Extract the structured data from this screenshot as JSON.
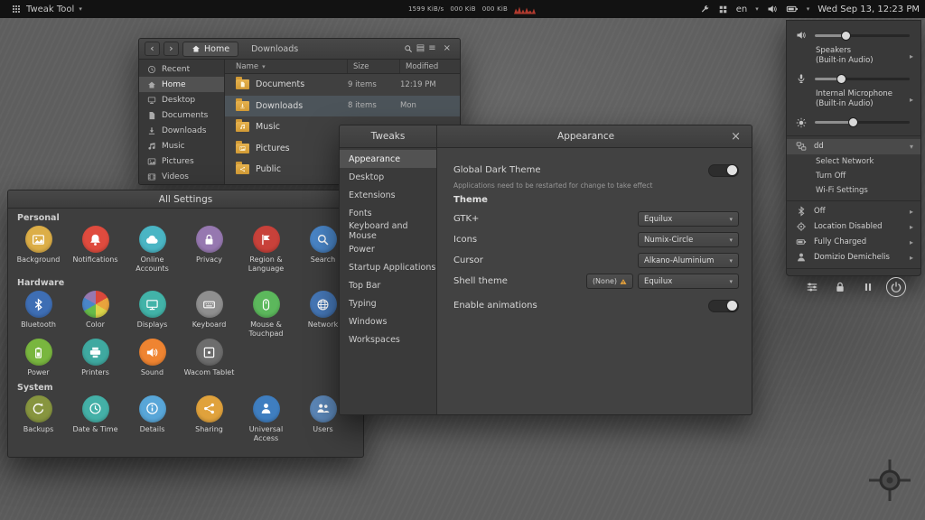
{
  "topbar": {
    "app_menu_label": "Tweak Tool",
    "net_rate": "1599 KiB/s",
    "net_down": "000 KiB",
    "net_up": "000 KiB",
    "keyboard_layout": "en",
    "clock": "Wed Sep 13, 12:23 PM"
  },
  "files_window": {
    "tabs": [
      {
        "label": "Home",
        "icon": "home"
      },
      {
        "label": "Downloads"
      }
    ],
    "sidebar_items": [
      {
        "label": "Recent",
        "icon": "recent-clock"
      },
      {
        "label": "Home",
        "icon": "home"
      },
      {
        "label": "Desktop",
        "icon": "desktop-monitor"
      },
      {
        "label": "Documents",
        "icon": "document"
      },
      {
        "label": "Downloads",
        "icon": "download-arrow"
      },
      {
        "label": "Music",
        "icon": "music-note"
      },
      {
        "label": "Pictures",
        "icon": "photo"
      },
      {
        "label": "Videos",
        "icon": "film"
      }
    ],
    "selected_sidebar": "Home",
    "columns": {
      "name": "Name",
      "size": "Size",
      "modified": "Modified"
    },
    "rows": [
      {
        "name": "Documents",
        "size": "9 items",
        "modified": "12:19 PM",
        "emblem": "document",
        "selected": false
      },
      {
        "name": "Downloads",
        "size": "8 items",
        "modified": "Mon",
        "emblem": "download-arrow",
        "selected": true
      },
      {
        "name": "Music",
        "size": "",
        "modified": "",
        "emblem": "music-note",
        "selected": false
      },
      {
        "name": "Pictures",
        "size": "",
        "modified": "",
        "emblem": "photo",
        "selected": false
      },
      {
        "name": "Public",
        "size": "",
        "modified": "",
        "emblem": "share",
        "selected": false
      }
    ]
  },
  "settings_window": {
    "title": "All Settings",
    "sections": [
      {
        "title": "Personal",
        "items": [
          {
            "label": "Background",
            "icon": "photo",
            "color": "#dcae47"
          },
          {
            "label": "Notifications",
            "icon": "bell",
            "color": "#df4b3e"
          },
          {
            "label": "Online Accounts",
            "icon": "cloud",
            "color": "#4ab5c4"
          },
          {
            "label": "Privacy",
            "icon": "lock",
            "color": "#9678b0"
          },
          {
            "label": "Region & Language",
            "icon": "flag",
            "color": "#c8413a"
          },
          {
            "label": "Search",
            "icon": "search",
            "color": "#4a86c8"
          }
        ]
      },
      {
        "title": "Hardware",
        "items": [
          {
            "label": "Bluetooth",
            "icon": "bluetooth",
            "color": "#3e6eb4"
          },
          {
            "label": "Color",
            "icon": "color-wheel",
            "color": ""
          },
          {
            "label": "Displays",
            "icon": "monitor",
            "color": "#42b3a8"
          },
          {
            "label": "Keyboard",
            "icon": "keyboard",
            "color": "#8f8f8f"
          },
          {
            "label": "Mouse & Touchpad",
            "icon": "mouse",
            "color": "#5cb85c"
          },
          {
            "label": "Network",
            "icon": "globe",
            "color": "#4678b8"
          },
          {
            "label": "Power",
            "icon": "battery",
            "color": "#79b63f"
          },
          {
            "label": "Printers",
            "icon": "printer",
            "color": "#3fa9a0"
          },
          {
            "label": "Sound",
            "icon": "speaker",
            "color": "#ef8431"
          },
          {
            "label": "Wacom Tablet",
            "icon": "tablet",
            "color": "#6d6d6d"
          }
        ]
      },
      {
        "title": "System",
        "items": [
          {
            "label": "Backups",
            "icon": "backup-arrows",
            "color": "#87953f"
          },
          {
            "label": "Date & Time",
            "icon": "clock",
            "color": "#44b0a7"
          },
          {
            "label": "Details",
            "icon": "info",
            "color": "#58a6d8"
          },
          {
            "label": "Sharing",
            "icon": "share",
            "color": "#e0a23c"
          },
          {
            "label": "Universal Access",
            "icon": "person",
            "color": "#3f7ec0"
          },
          {
            "label": "Users",
            "icon": "people",
            "color": "#5c87b8"
          }
        ]
      }
    ]
  },
  "tweaks_window": {
    "sidebar_title": "Tweaks",
    "page_title": "Appearance",
    "sidebar_items": [
      {
        "label": "Appearance",
        "selected": true
      },
      {
        "label": "Desktop",
        "selected": false
      },
      {
        "label": "Extensions",
        "selected": false
      },
      {
        "label": "Fonts",
        "selected": false
      },
      {
        "label": "Keyboard and Mouse",
        "selected": false
      },
      {
        "label": "Power",
        "selected": false
      },
      {
        "label": "Startup Applications",
        "selected": false
      },
      {
        "label": "Top Bar",
        "selected": false
      },
      {
        "label": "Typing",
        "selected": false
      },
      {
        "label": "Windows",
        "selected": false
      },
      {
        "label": "Workspaces",
        "selected": false
      }
    ],
    "dark_theme": {
      "label": "Global Dark Theme",
      "on": true,
      "note": "Applications need to be restarted for change to take effect"
    },
    "theme_heading": "Theme",
    "rows": [
      {
        "label": "GTK+",
        "value": "Equilux"
      },
      {
        "label": "Icons",
        "value": "Numix-Circle"
      },
      {
        "label": "Cursor",
        "value": "Alkano-Aluminium"
      },
      {
        "label": "Shell theme",
        "none_label": "(None)",
        "value": "Equilux"
      }
    ],
    "animations": {
      "label": "Enable animations",
      "on": true
    }
  },
  "system_menu": {
    "output": {
      "device": "Speakers",
      "detail": "(Built-in Audio)",
      "volume": 33
    },
    "input": {
      "device": "Internal Microphone",
      "detail": "(Built-in Audio)",
      "volume": 29
    },
    "brightness": 41,
    "network": {
      "name": "dd",
      "items": [
        "Select Network",
        "Turn Off",
        "Wi-Fi Settings"
      ]
    },
    "bluetooth_status": "Off",
    "location_status": "Location Disabled",
    "battery_status": "Fully Charged",
    "user_name": "Domizio Demichelis"
  }
}
